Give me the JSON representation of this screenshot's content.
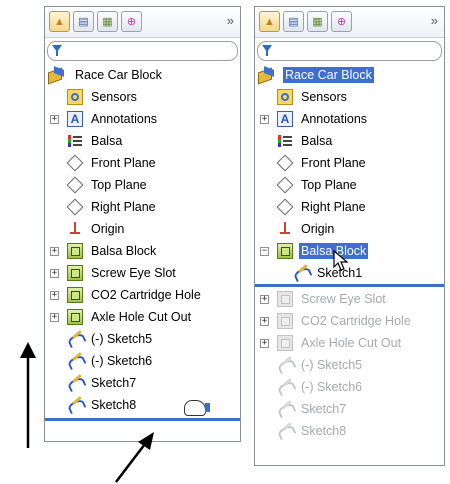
{
  "left_panel": {
    "more_label": "»",
    "root": "Race Car Block",
    "items": [
      {
        "label": "Sensors",
        "icon": "sensors-icon"
      },
      {
        "label": "Annotations",
        "icon": "annotations-icon"
      },
      {
        "label": "Balsa",
        "icon": "material-icon"
      },
      {
        "label": "Front Plane",
        "icon": "plane-icon"
      },
      {
        "label": "Top Plane",
        "icon": "plane-icon"
      },
      {
        "label": "Right Plane",
        "icon": "plane-icon"
      },
      {
        "label": "Origin",
        "icon": "origin-icon"
      },
      {
        "label": "Balsa Block",
        "icon": "feature-icon"
      },
      {
        "label": "Screw Eye Slot",
        "icon": "feature-icon"
      },
      {
        "label": "CO2 Cartridge Hole",
        "icon": "feature-icon"
      },
      {
        "label": "Axle Hole Cut Out",
        "icon": "feature-icon"
      },
      {
        "label": "(-) Sketch5",
        "icon": "sketch-icon"
      },
      {
        "label": "(-) Sketch6",
        "icon": "sketch-icon"
      },
      {
        "label": "Sketch7",
        "icon": "sketch-icon"
      },
      {
        "label": "Sketch8",
        "icon": "sketch-icon"
      }
    ]
  },
  "right_panel": {
    "more_label": "»",
    "root": "Race Car Block",
    "items": [
      {
        "label": "Sensors",
        "icon": "sensors-icon"
      },
      {
        "label": "Annotations",
        "icon": "annotations-icon"
      },
      {
        "label": "Balsa",
        "icon": "material-icon"
      },
      {
        "label": "Front Plane",
        "icon": "plane-icon"
      },
      {
        "label": "Top Plane",
        "icon": "plane-icon"
      },
      {
        "label": "Right Plane",
        "icon": "plane-icon"
      },
      {
        "label": "Origin",
        "icon": "origin-icon"
      },
      {
        "label": "Balsa Block",
        "icon": "feature-icon",
        "selected": true
      },
      {
        "label": "Sketch1",
        "icon": "sketch-icon"
      },
      {
        "label": "Screw Eye Slot",
        "icon": "feature-icon",
        "suppressed": true
      },
      {
        "label": "CO2 Cartridge Hole",
        "icon": "feature-icon",
        "suppressed": true
      },
      {
        "label": "Axle Hole Cut Out",
        "icon": "feature-icon",
        "suppressed": true
      },
      {
        "label": "(-) Sketch5",
        "icon": "sketch-icon",
        "suppressed": true
      },
      {
        "label": "(-) Sketch6",
        "icon": "sketch-icon",
        "suppressed": true
      },
      {
        "label": "Sketch7",
        "icon": "sketch-icon",
        "suppressed": true
      },
      {
        "label": "Sketch8",
        "icon": "sketch-icon",
        "suppressed": true
      }
    ]
  },
  "colors": {
    "selection": "#3d6fcf",
    "rollback_bar": "#3a70c9",
    "suppressed_text": "#a7a9ad"
  }
}
